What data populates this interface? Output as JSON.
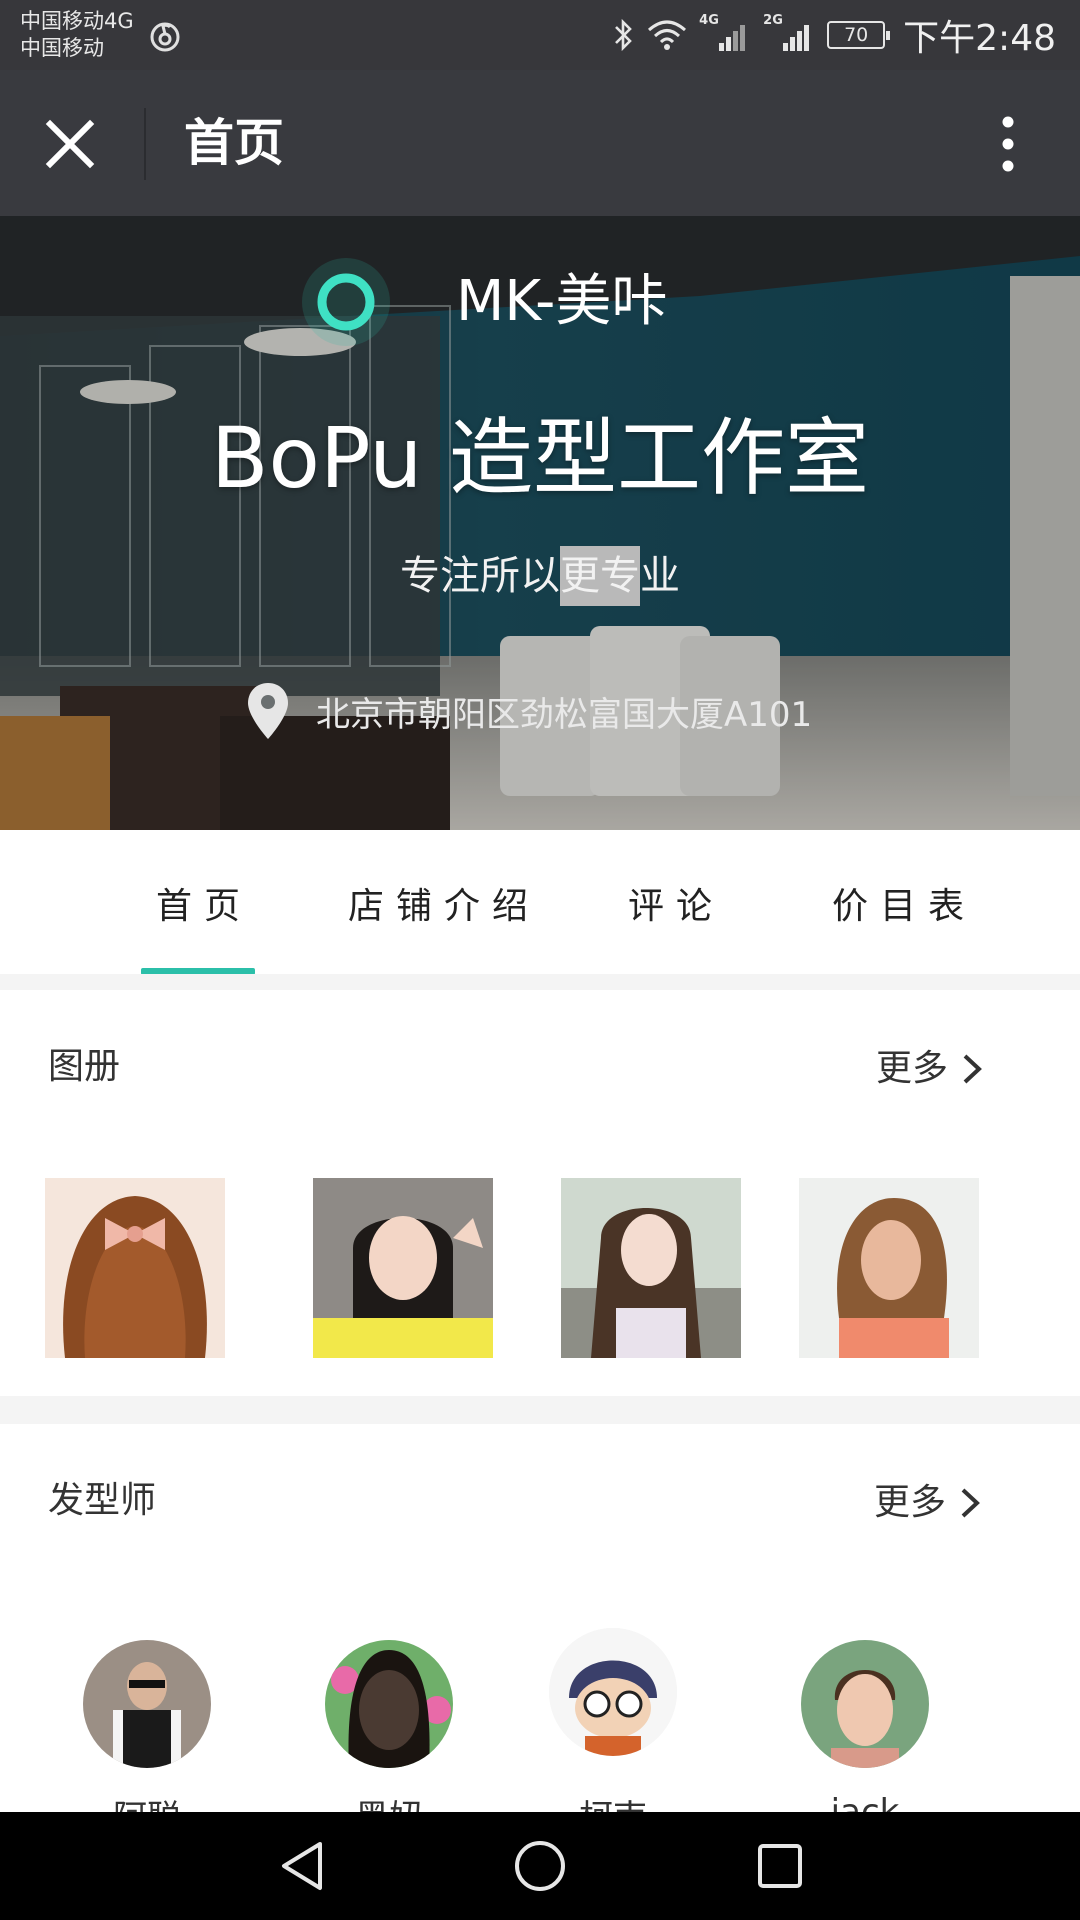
{
  "status_bar": {
    "carrier_line1": "中国移动4G",
    "carrier_line2": "中国移动",
    "network_a": "4G",
    "network_b": "2G",
    "battery": "70",
    "time": "下午2:48"
  },
  "nav": {
    "title": "首页",
    "close_icon": "close-icon",
    "more_icon": "more-vertical-icon"
  },
  "hero": {
    "shop_name": "MK-美咔",
    "studio_title": "BoPu 造型工作室",
    "slogan": "专注所以更专业",
    "address": "北京市朝阳区劲松富国大厦A101",
    "accent_color": "#2bbfa9"
  },
  "tabs": [
    {
      "label": "首页",
      "active": true
    },
    {
      "label": "店铺介绍",
      "active": false
    },
    {
      "label": "评论",
      "active": false
    },
    {
      "label": "价目表",
      "active": false
    }
  ],
  "album": {
    "title": "图册",
    "more_label": "更多"
  },
  "stylists": {
    "title": "发型师",
    "more_label": "更多",
    "names": [
      "阿聪",
      "黑妞",
      "柯南",
      "jack"
    ]
  }
}
